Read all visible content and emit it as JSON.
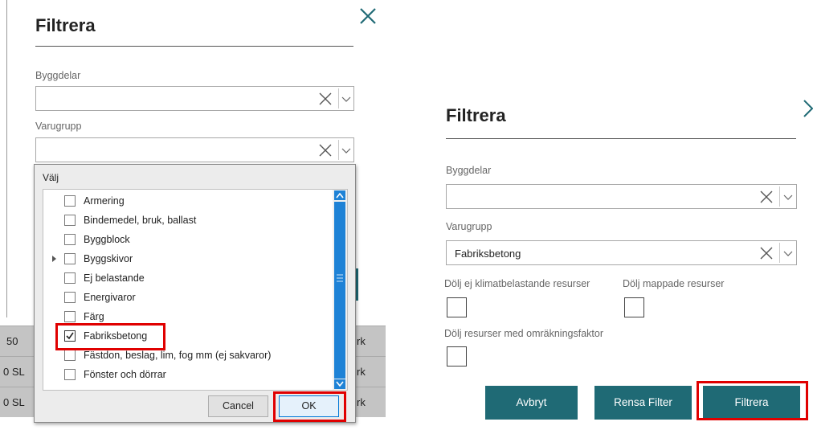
{
  "left": {
    "title": "Filtrera",
    "byggdelar_label": "Byggdelar",
    "varugrupp_label": "Varugrupp",
    "background_rows": [
      {
        "left": "50",
        "right": "rk"
      },
      {
        "left": "0 SL",
        "right": "rk"
      },
      {
        "left": "0 SL",
        "right": "rk"
      }
    ],
    "popup": {
      "header": "Välj",
      "items": [
        {
          "label": "Armering",
          "checked": false,
          "expandable": false
        },
        {
          "label": "Bindemedel, bruk, ballast",
          "checked": false,
          "expandable": false
        },
        {
          "label": "Byggblock",
          "checked": false,
          "expandable": false
        },
        {
          "label": "Byggskivor",
          "checked": false,
          "expandable": true
        },
        {
          "label": "Ej belastande",
          "checked": false,
          "expandable": false
        },
        {
          "label": "Energivaror",
          "checked": false,
          "expandable": false
        },
        {
          "label": "Färg",
          "checked": false,
          "expandable": false
        },
        {
          "label": "Fabriksbetong",
          "checked": true,
          "expandable": false
        },
        {
          "label": "Fästdon, beslag, lim, fog mm (ej sakvaror)",
          "checked": false,
          "expandable": false
        },
        {
          "label": "Fönster och dörrar",
          "checked": false,
          "expandable": false
        }
      ],
      "cancel_label": "Cancel",
      "ok_label": "OK"
    }
  },
  "right": {
    "title": "Filtrera",
    "byggdelar_label": "Byggdelar",
    "byggdelar_value": "",
    "varugrupp_label": "Varugrupp",
    "varugrupp_value": "Fabriksbetong",
    "opt_hide_non_climate": "Dölj ej klimatbelastande resurser",
    "opt_hide_mapped": "Dölj mappade resurser",
    "opt_hide_conversion": "Dölj resurser med omräkningsfaktor",
    "avbryt_label": "Avbryt",
    "rensa_label": "Rensa Filter",
    "filtrera_label": "Filtrera"
  },
  "colors": {
    "accent_teal": "#1f6a75",
    "highlight_red": "#e00000",
    "checkmark_blue": "#1e82d6"
  },
  "icons": [
    "close-icon",
    "clear-x-icon",
    "chevron-down-icon",
    "checkmark-icon",
    "expand-arrow-icon",
    "scroll-up-icon",
    "scroll-down-icon"
  ]
}
